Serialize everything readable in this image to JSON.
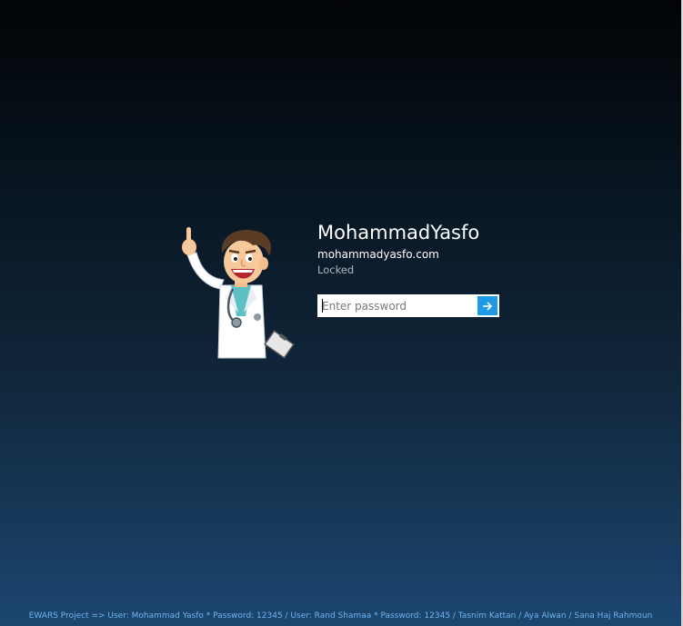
{
  "user": {
    "name": "MohammadYasfo",
    "domain": "mohammadyasfo.com",
    "status": "Locked"
  },
  "password": {
    "placeholder": "Enter password",
    "value": ""
  },
  "submit": {
    "icon": "arrow-right-icon"
  },
  "footer": {
    "text": "EWARS Project  =>  User: Mohammad Yasfo * Password: 12345 / User: Rand Shamaa * Password: 12345 / Tasnim Kattan / Aya Alwan / Sana Haj Rahmoun"
  },
  "colors": {
    "accent": "#1e9ae8",
    "footer_text": "#6fb4ee",
    "status_text": "#aeb6bf"
  }
}
